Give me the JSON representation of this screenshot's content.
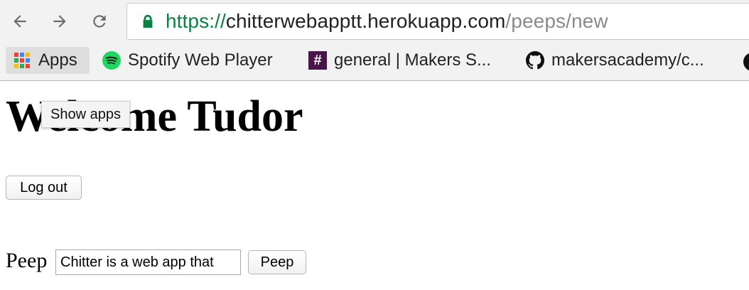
{
  "browser": {
    "url_scheme": "https://",
    "url_host": "chitterwebapptt.herokuapp.com",
    "url_path": "/peeps/new",
    "bookmarks": [
      {
        "label": "Apps"
      },
      {
        "label": "Spotify Web Player"
      },
      {
        "label": "general | Makers S..."
      },
      {
        "label": "makersacademy/c..."
      }
    ],
    "tooltip": "Show apps"
  },
  "page": {
    "title": "Welcome Tudor",
    "logout_label": "Log out",
    "peep_label": "Peep",
    "peep_value": "Chitter is a web app that",
    "peep_button_label": "Peep"
  },
  "colors": {
    "secure_green": "#0b8043",
    "spotify_green": "#1ed760",
    "slack_purple": "#4a154b"
  }
}
